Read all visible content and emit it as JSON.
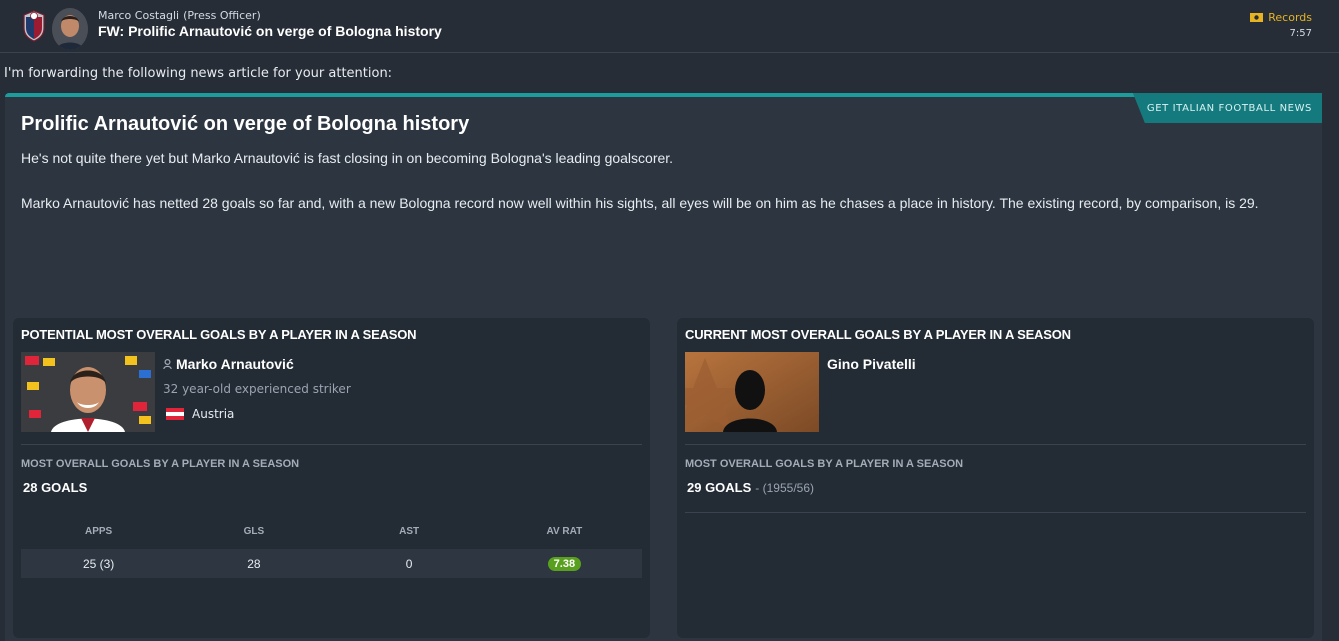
{
  "header": {
    "sender_name": "Marco Costagli",
    "sender_role": "(Press Officer)",
    "subject": "FW: Prolific Arnautović on verge of Bologna history",
    "records_label": "Records",
    "time": "7:57"
  },
  "intro": "I'm forwarding the following news article for your attention:",
  "article": {
    "news_tab": "GET ITALIAN FOOTBALL NEWS",
    "title": "Prolific Arnautović on verge of Bologna history",
    "paragraph1": "He's not quite there yet but Marko Arnautović is fast closing in on becoming Bologna's leading goalscorer.",
    "paragraph2": "Marko Arnautović has netted 28 goals so far and, with a new Bologna record now well within his sights, all eyes will be on him as he chases a place in history. The existing record, by comparison, is 29."
  },
  "potential": {
    "title": "POTENTIAL MOST OVERALL GOALS BY A PLAYER IN A SEASON",
    "player_name": "Marko Arnautović",
    "description": "32 year-old experienced striker",
    "nationality": "Austria",
    "stat_label": "MOST OVERALL GOALS BY A PLAYER IN A SEASON",
    "goals": "28 GOALS",
    "table": {
      "headers": [
        "APPS",
        "GLS",
        "AST",
        "AV RAT"
      ],
      "values": [
        "25 (3)",
        "28",
        "0",
        "7.38"
      ]
    }
  },
  "current": {
    "title": "CURRENT MOST OVERALL GOALS BY A PLAYER IN A SEASON",
    "player_name": "Gino Pivatelli",
    "stat_label": "MOST OVERALL GOALS BY A PLAYER IN A SEASON",
    "goals": "29 GOALS",
    "season": "- (1955/56)"
  },
  "icons": {
    "club_badge": "bologna-crest-icon",
    "records": "records-icon",
    "person": "person-icon",
    "flag": "austria-flag-icon"
  },
  "colors": {
    "accent_teal": "#1c9c9c",
    "records_gold": "#e6b422",
    "rating_green": "#5aa01f"
  }
}
